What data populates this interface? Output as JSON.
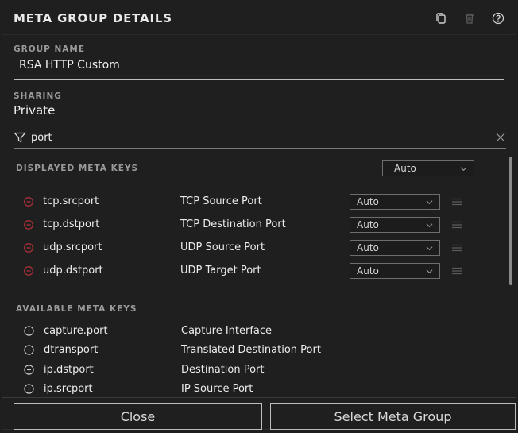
{
  "header": {
    "title": "META GROUP DETAILS",
    "icons": [
      "copy-icon",
      "trash-icon",
      "help-icon"
    ]
  },
  "group_name": {
    "label": "GROUP NAME",
    "value": "RSA HTTP Custom"
  },
  "sharing": {
    "label": "SHARING",
    "value": "Private"
  },
  "filter": {
    "value": "port",
    "icon": "filter-icon"
  },
  "displayed": {
    "label": "DISPLAYED META KEYS",
    "master_select": "Auto",
    "rows": [
      {
        "key": "tcp.srcport",
        "description": "TCP Source Port",
        "option": "Auto"
      },
      {
        "key": "tcp.dstport",
        "description": "TCP Destination Port",
        "option": "Auto"
      },
      {
        "key": "udp.srcport",
        "description": "UDP Source Port",
        "option": "Auto"
      },
      {
        "key": "udp.dstport",
        "description": "UDP Target Port",
        "option": "Auto"
      }
    ]
  },
  "available": {
    "label": "AVAILABLE META KEYS",
    "rows": [
      {
        "key": "capture.port",
        "description": "Capture Interface"
      },
      {
        "key": "dtransport",
        "description": "Translated Destination Port"
      },
      {
        "key": "ip.dstport",
        "description": "Destination Port"
      },
      {
        "key": "ip.srcport",
        "description": "IP Source Port"
      }
    ]
  },
  "footer": {
    "close_label": "Close",
    "select_label": "Select Meta Group"
  },
  "colors": {
    "background": "#1f1f1f",
    "remove_icon": "#b8323a",
    "text": "#ececec",
    "muted_label": "#9a9a9a"
  }
}
